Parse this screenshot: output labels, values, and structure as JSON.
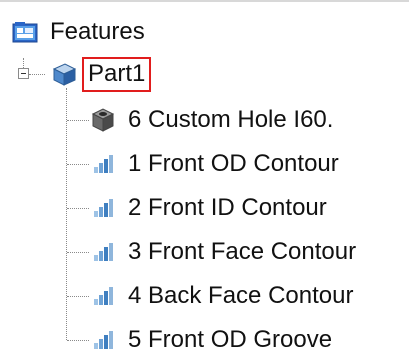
{
  "tree": {
    "root_label": "Features",
    "part_label": "Part1",
    "items": [
      {
        "label": "6 Custom Hole I60.",
        "icon": "custom-hole-icon"
      },
      {
        "label": "1 Front OD Contour",
        "icon": "contour-icon"
      },
      {
        "label": "2 Front ID Contour",
        "icon": "contour-icon"
      },
      {
        "label": "3 Front Face Contour",
        "icon": "contour-icon"
      },
      {
        "label": "4 Back Face Contour",
        "icon": "contour-icon"
      },
      {
        "label": "5 Front OD Groove",
        "icon": "contour-icon"
      }
    ]
  },
  "colors": {
    "selection_border": "#e11d1d",
    "tree_line": "#8a8a8a",
    "text": "#111111"
  }
}
